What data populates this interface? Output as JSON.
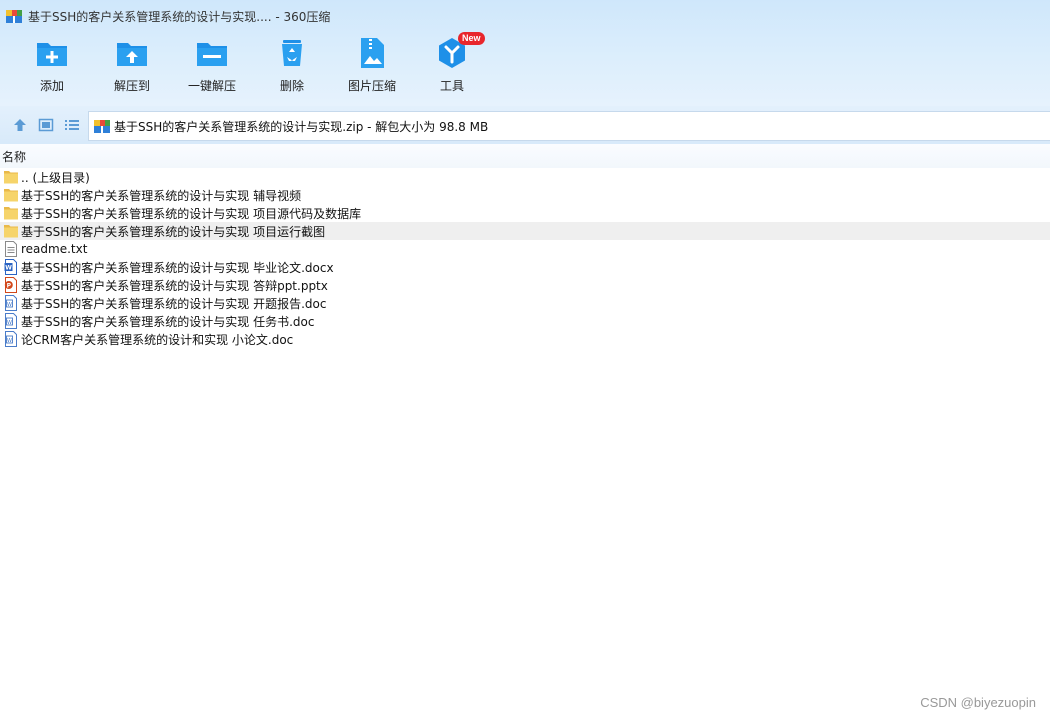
{
  "window": {
    "title": "基于SSH的客户关系管理系统的设计与实现.... - 360压缩"
  },
  "toolbar": {
    "add_label": "添加",
    "extract_to_label": "解压到",
    "one_click_extract_label": "一键解压",
    "delete_label": "删除",
    "image_compress_label": "图片压缩",
    "tools_label": "工具",
    "tools_badge": "New"
  },
  "navbar": {
    "path_text": "基于SSH的客户关系管理系统的设计与实现.zip - 解包大小为 98.8 MB"
  },
  "list": {
    "column_name": "名称",
    "items": [
      {
        "name": ".. (上级目录)",
        "type": "folder-icon"
      },
      {
        "name": "基于SSH的客户关系管理系统的设计与实现 辅导视频",
        "type": "folder-icon"
      },
      {
        "name": "基于SSH的客户关系管理系统的设计与实现 项目源代码及数据库",
        "type": "folder-icon"
      },
      {
        "name": "基于SSH的客户关系管理系统的设计与实现 项目运行截图",
        "type": "folder-icon",
        "selected": true
      },
      {
        "name": "readme.txt",
        "type": "text-file-icon"
      },
      {
        "name": "基于SSH的客户关系管理系统的设计与实现 毕业论文.docx",
        "type": "word-file-icon"
      },
      {
        "name": "基于SSH的客户关系管理系统的设计与实现 答辩ppt.pptx",
        "type": "ppt-file-icon"
      },
      {
        "name": "基于SSH的客户关系管理系统的设计与实现 开题报告.doc",
        "type": "doc-file-icon"
      },
      {
        "name": "基于SSH的客户关系管理系统的设计与实现 任务书.doc",
        "type": "doc-file-icon"
      },
      {
        "name": "论CRM客户关系管理系统的设计和实现 小论文.doc",
        "type": "doc-file-icon"
      }
    ]
  },
  "watermark": "CSDN @biyezuopin",
  "colors": {
    "accent": "#1e90e8",
    "icon_blue": "#2196f3",
    "folder": "#f6d46a",
    "badge": "#e8262c"
  }
}
